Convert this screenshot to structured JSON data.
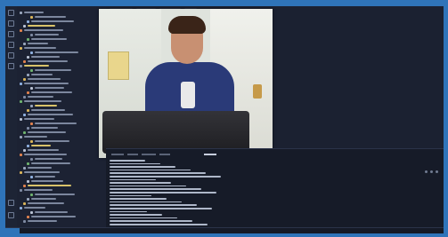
{
  "colors": {
    "bezel": "#2f74b9",
    "editor_bg": "#1a2031",
    "terminal_bg": "#161b28"
  },
  "activity_bar": {
    "icons": [
      "files-icon",
      "search-icon",
      "source-control-icon",
      "debug-icon",
      "extensions-icon",
      "testing-icon",
      "account-icon",
      "settings-icon"
    ]
  },
  "webcam": {
    "description_icon": "video-preview"
  }
}
